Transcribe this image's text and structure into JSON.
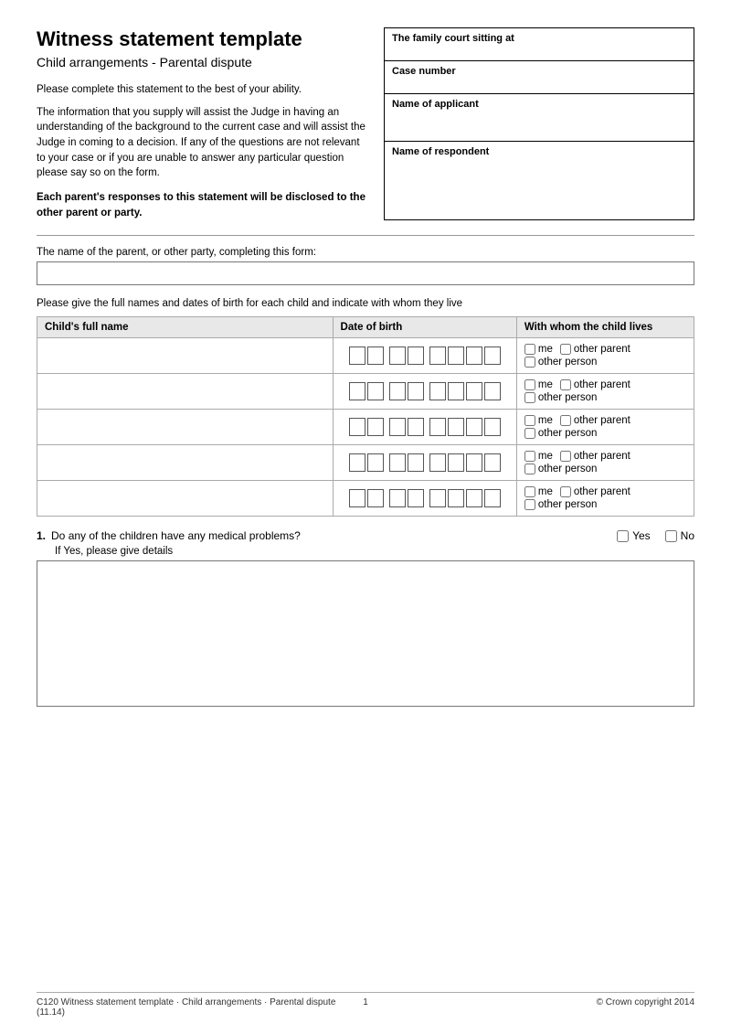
{
  "title": "Witness statement template",
  "subtitle": "Child arrangements - Parental dispute",
  "intro1": "Please complete this statement to the best of your ability.",
  "intro2": "The information that you supply will assist the Judge in having an understanding of the background to the current case and will assist the Judge in coming to a decision. If any of the questions are not relevant to your case or if you are unable to answer any particular question please say so on the form.",
  "bold_notice": "Each parent's responses to this statement will be disclosed to the other parent or party.",
  "court_box": {
    "row1_label": "The family court sitting at",
    "row2_label": "Case number",
    "row3_label": "Name of applicant",
    "row4_label": "Name of respondent"
  },
  "name_field_label": "The name of the parent, or other party, completing this form:",
  "children_table": {
    "col1": "Child's full name",
    "col2": "Date of birth",
    "col3": "With whom the child lives",
    "rows": [
      {
        "id": 1
      },
      {
        "id": 2
      },
      {
        "id": 3
      },
      {
        "id": 4
      },
      {
        "id": 5
      }
    ],
    "checkbox_labels": {
      "me": "me",
      "other_parent": "other parent",
      "other_person": "other person"
    }
  },
  "children_intro": "Please give the full names and dates of birth for each child and indicate with whom they live",
  "question1": {
    "number": "1.",
    "text": "Do any of the children have any medical problems?",
    "yes_label": "Yes",
    "no_label": "No",
    "if_yes": "If Yes, please give details"
  },
  "footer": {
    "left": "C120 Witness statement template · Child arrangements · Parental dispute (11.14)",
    "center": "1",
    "right": "© Crown copyright 2014"
  }
}
